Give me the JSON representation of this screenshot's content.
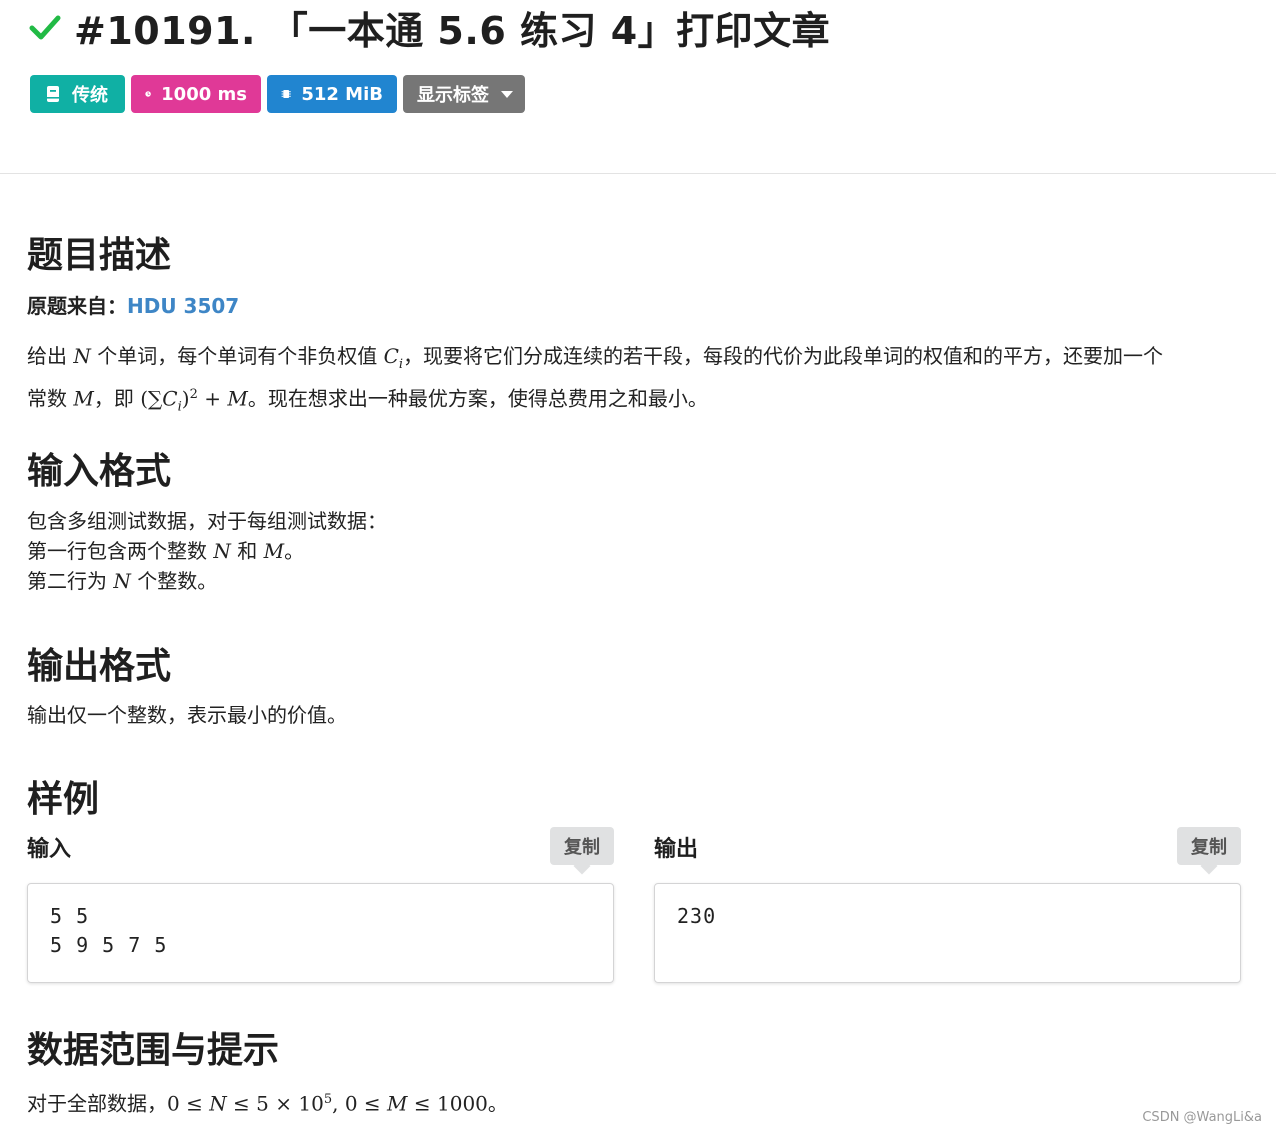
{
  "problem": {
    "title": "#10191. 「一本通 5.6 练习 4」打印文章",
    "labels": {
      "type": "传统",
      "time": "1000 ms",
      "memory": "512 MiB",
      "tags": "显示标签"
    }
  },
  "sections": {
    "description": {
      "heading": "题目描述",
      "source_label": "原题来自：",
      "source_link": "HDU 3507",
      "line1_a": "给出 ",
      "var_N": "N",
      "line1_b": " 个单词，每个单词有个非负权值 ",
      "var_C": "C",
      "var_i": "i",
      "line1_c": "，现要将它们分成连续的若干段，每段的代价为此段单词的权值和的平方，还要加一个",
      "line2_a": "常数 ",
      "var_M": "M",
      "line2_b": "，即 ",
      "formula_open": "(∑",
      "formula_close": ")",
      "formula_exp": "2",
      "formula_plus": " + ",
      "line2_c": "。现在想求出一种最优方案，使得总费用之和最小。"
    },
    "input": {
      "heading": "输入格式",
      "line1": "包含多组测试数据，对于每组测试数据：",
      "line2_a": "第一行包含两个整数 ",
      "line2_b": " 和 ",
      "line2_c": "。",
      "line3_a": "第二行为 ",
      "line3_b": " 个整数。"
    },
    "output": {
      "heading": "输出格式",
      "line1": "输出仅一个整数，表示最小的价值。"
    },
    "sample": {
      "heading": "样例",
      "input_title": "输入",
      "output_title": "输出",
      "copy_label": "复制",
      "input_text": "5 5\n5 9 5 7 5",
      "output_text": "230"
    },
    "constraints": {
      "heading": "数据范围与提示",
      "prefix": "对于全部数据，",
      "c1": "0 ≤ ",
      "c2": " ≤ 5 × 10",
      "exp5": "5",
      "sep": ", ",
      "c3": "0 ≤ ",
      "c4": " ≤ 1000",
      "suffix": "。"
    }
  },
  "watermark": "CSDN @WangLi&a",
  "colors": {
    "accepted": "#21ba45",
    "type_label": "#10b0a4",
    "time_label": "#e03997",
    "memory_label": "#2185d0",
    "tags_label": "#767676",
    "link": "#3e86c6"
  },
  "icons": {
    "status": "check-icon",
    "type": "book-icon",
    "time": "clock-icon",
    "memory": "chip-icon",
    "tags": "caret-down-icon"
  }
}
